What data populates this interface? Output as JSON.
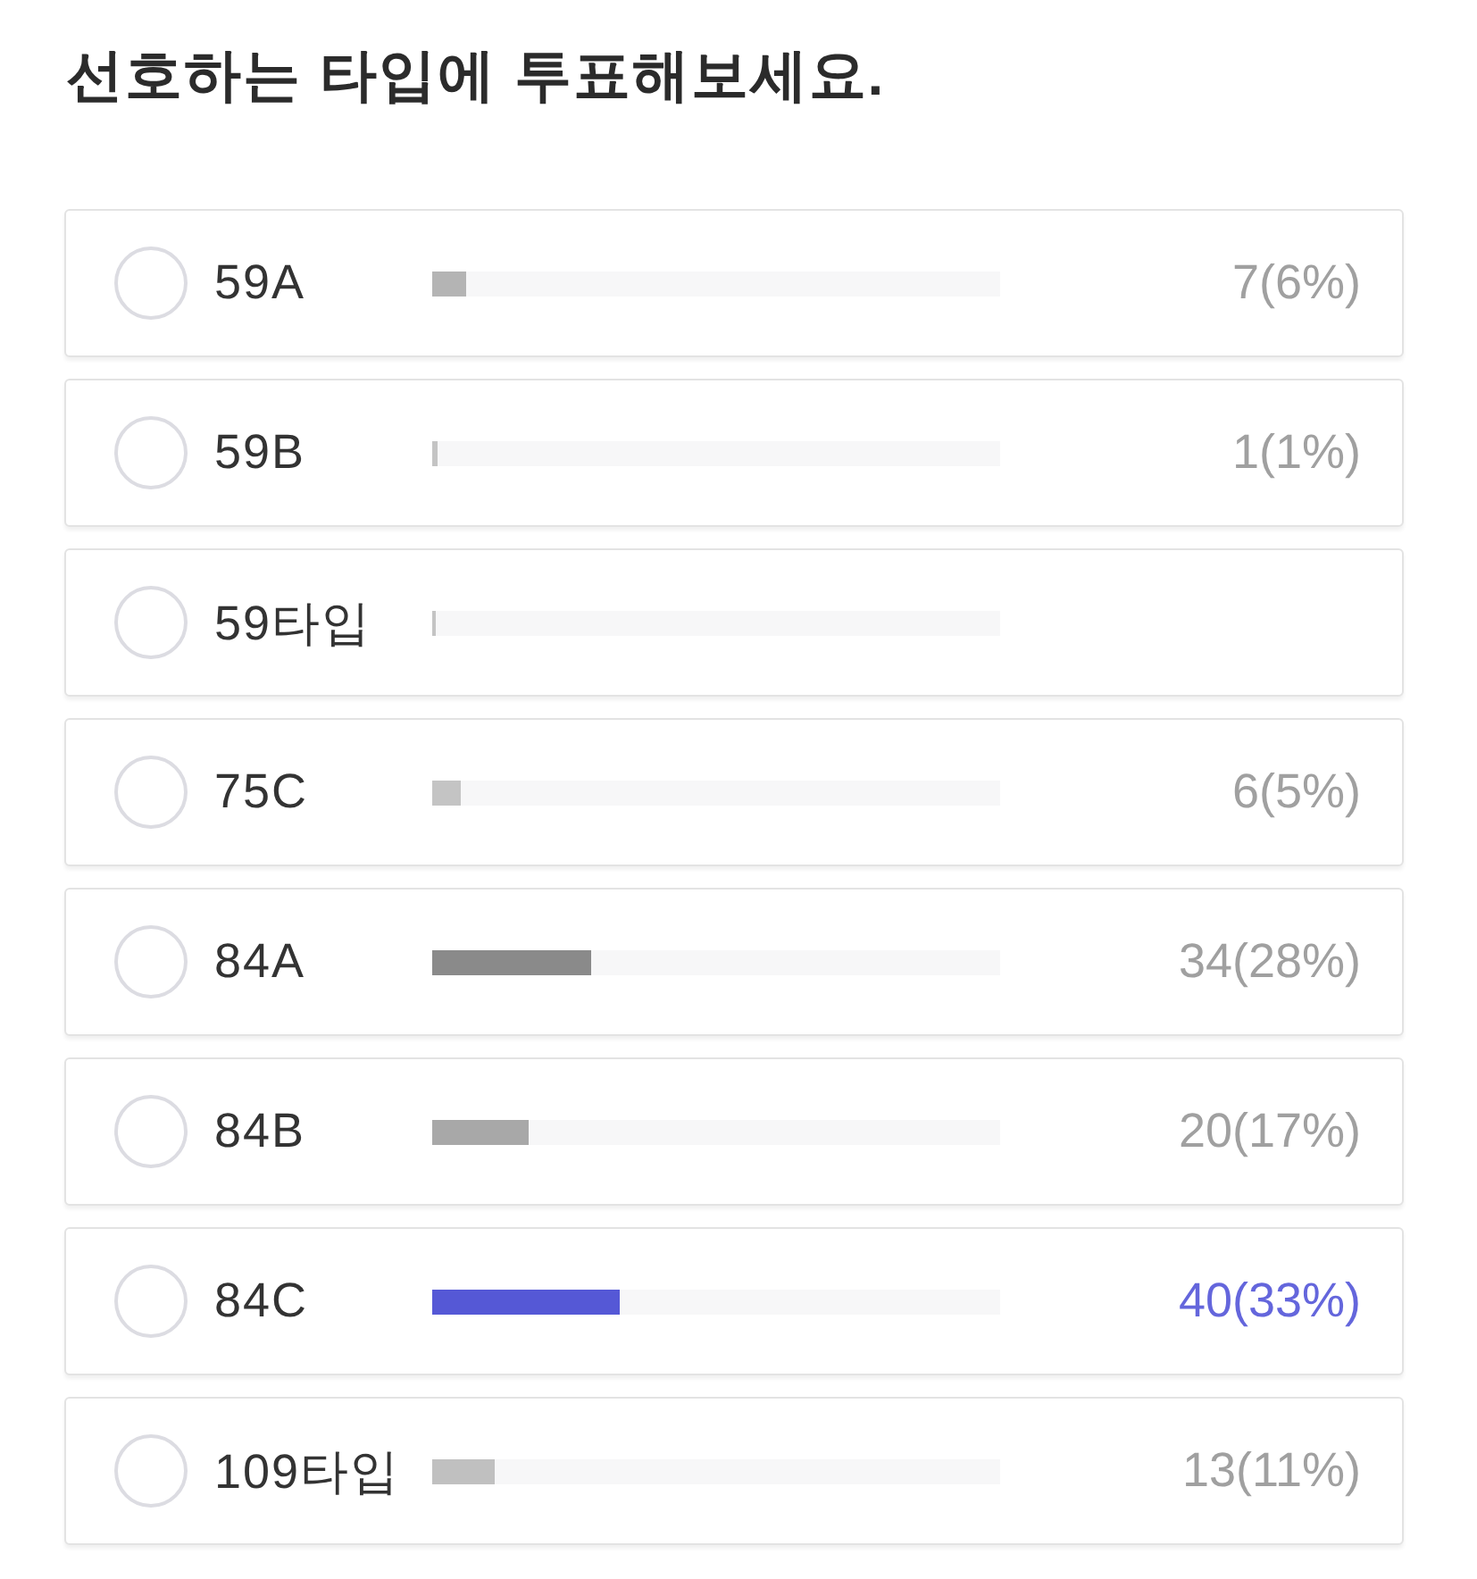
{
  "title": "선호하는 타입에 투표해보세요.",
  "options": [
    {
      "label": "59A",
      "selected": false,
      "level": 0.06,
      "color": "#b4b4b4",
      "count": "7(6%)",
      "leading": false
    },
    {
      "label": "59B",
      "selected": false,
      "level": 0.01,
      "color": "#c4c4c4",
      "count": "1(1%)",
      "leading": false
    },
    {
      "label": "59타입",
      "selected": false,
      "level": 0.006,
      "color": "#c4c4c4"
    },
    {
      "label": "75C",
      "selected": false,
      "level": 0.05,
      "color": "#c4c4c4",
      "count": "6(5%)",
      "leading": false
    },
    {
      "label": "84A",
      "selected": false,
      "level": 0.28,
      "color": "#8a8a8a",
      "count": "34(28%)",
      "leading": false
    },
    {
      "label": "84B",
      "selected": false,
      "level": 0.17,
      "color": "#a8a8a8",
      "count": "20(17%)",
      "leading": false
    },
    {
      "label": "84C",
      "selected": false,
      "level": 0.33,
      "color": "#5558d6",
      "count": "40(33%)",
      "leading": true
    },
    {
      "label": "109타입",
      "selected": false,
      "level": 0.11,
      "color": "#c0c0c0",
      "count": "13(11%)",
      "leading": false
    }
  ]
}
